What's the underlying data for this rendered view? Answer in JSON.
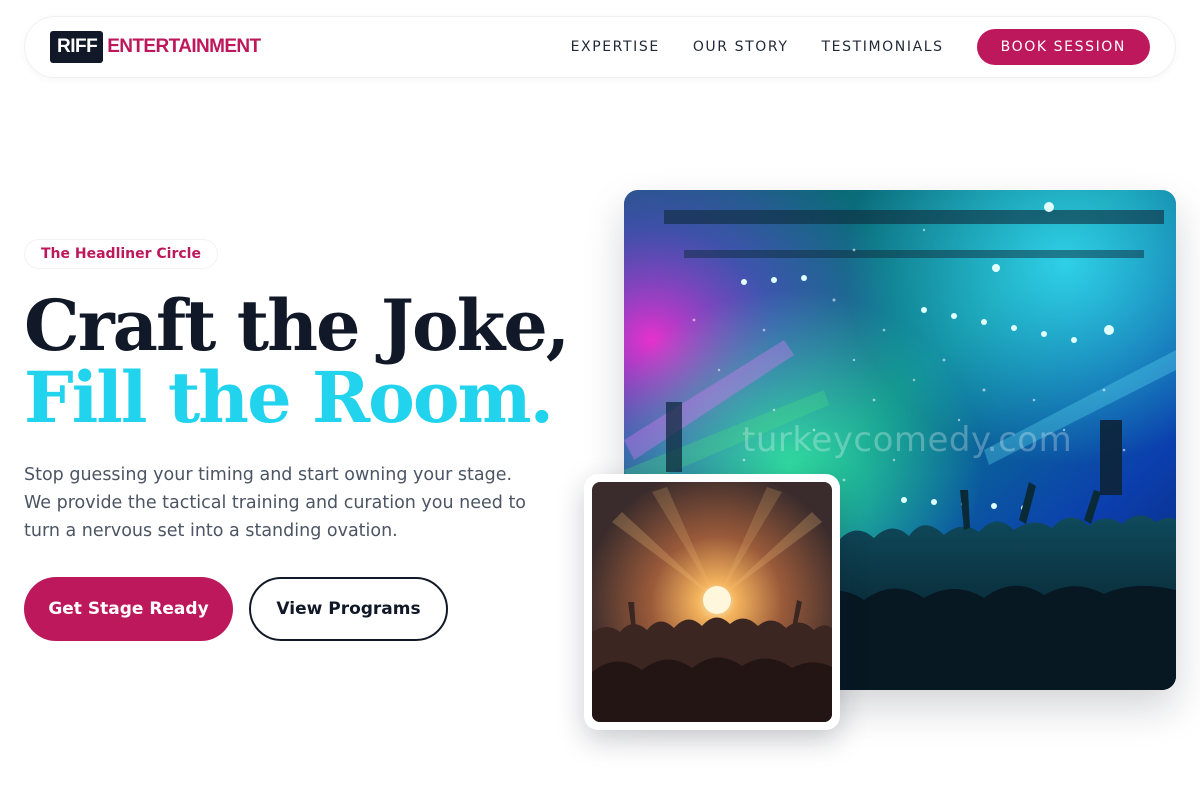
{
  "nav": {
    "logo_mark": "RIFF",
    "logo_text": "ENTERTAINMENT",
    "links": [
      "EXPERTISE",
      "OUR STORY",
      "TESTIMONIALS"
    ],
    "cta": "BOOK SESSION"
  },
  "hero": {
    "badge": "The Headliner Circle",
    "headline_line1": "Craft the Joke,",
    "headline_line2": "Fill the Room.",
    "lead": "Stop guessing your timing and start owning your stage. We provide the tactical training and curation you need to turn a nervous set into a standing ovation.",
    "primary_button": "Get Stage Ready",
    "secondary_button": "View Programs"
  },
  "images": {
    "watermark": "turkeycomedy.com"
  },
  "colors": {
    "brand": "#be185d",
    "accent": "#22d3ee",
    "ink": "#111827"
  }
}
